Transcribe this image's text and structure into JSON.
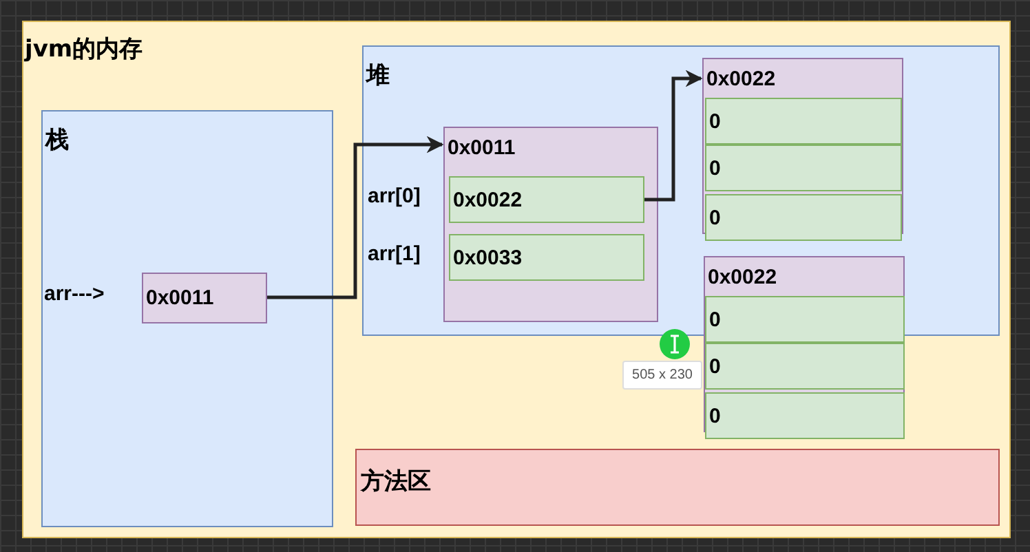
{
  "diagram": {
    "title": "jvm的内存",
    "stack": {
      "label": "栈",
      "variables": [
        {
          "name": "arr--->",
          "value": "0x0011"
        }
      ]
    },
    "heap": {
      "label": "堆",
      "objects": [
        {
          "address": "0x0011",
          "cells": [
            {
              "label": "arr[0]",
              "value": "0x0022"
            },
            {
              "label": "arr[1]",
              "value": "0x0033"
            }
          ]
        },
        {
          "address": "0x0022",
          "cells": [
            {
              "value": "0"
            },
            {
              "value": "0"
            },
            {
              "value": "0"
            }
          ]
        },
        {
          "address": "0x0022",
          "cells": [
            {
              "value": "0"
            },
            {
              "value": "0"
            },
            {
              "value": "0"
            }
          ]
        }
      ]
    },
    "method_area": {
      "label": "方法区"
    },
    "size_tooltip": "505 x 230"
  }
}
